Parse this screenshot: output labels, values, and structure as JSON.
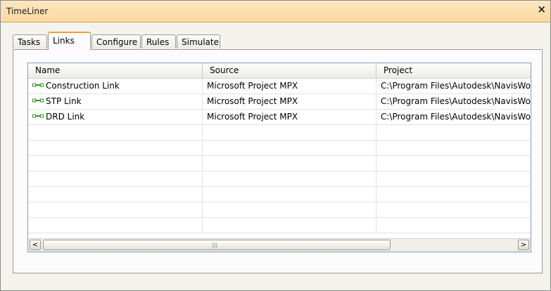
{
  "window": {
    "title": "TimeLiner",
    "close_glyph": "×"
  },
  "tabs": [
    {
      "label": "Tasks",
      "active": false
    },
    {
      "label": "Links",
      "active": true
    },
    {
      "label": "Configure",
      "active": false
    },
    {
      "label": "Rules",
      "active": false
    },
    {
      "label": "Simulate",
      "active": false
    }
  ],
  "table": {
    "columns": [
      "Name",
      "Source",
      "Project"
    ],
    "rows": [
      {
        "name": "Construction Link",
        "source": "Microsoft Project MPX",
        "project": "C:\\Program Files\\Autodesk\\NavisWo..."
      },
      {
        "name": "STP Link",
        "source": "Microsoft Project MPX",
        "project": "C:\\Program Files\\Autodesk\\NavisWo..."
      },
      {
        "name": "DRD Link",
        "source": "Microsoft Project MPX",
        "project": "C:\\Program Files\\Autodesk\\NavisWo..."
      }
    ],
    "row_icon": "link-icon"
  },
  "scrollbar": {
    "left_glyph": "<",
    "right_glyph": ">",
    "grip_glyph": "|||"
  },
  "colors": {
    "title_bg": "#fbd8a0",
    "active_tab_accent": "#f0a030",
    "link_icon": "#2a9a1e"
  }
}
